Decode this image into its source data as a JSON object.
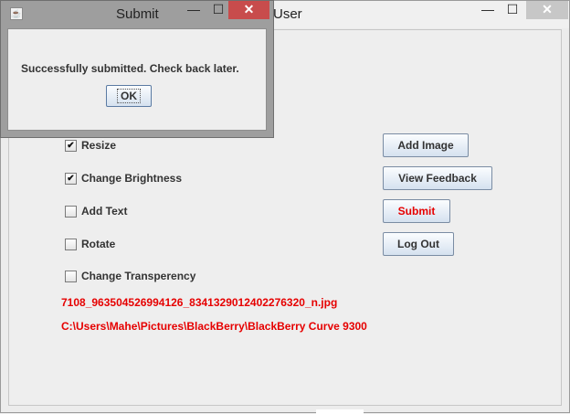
{
  "main_window": {
    "title": "User",
    "controls": {
      "minimize": "—",
      "maximize": "☐",
      "close": "✕"
    }
  },
  "options": [
    {
      "label": "Resize",
      "checked": true
    },
    {
      "label": "Change Brightness",
      "checked": true
    },
    {
      "label": "Add Text",
      "checked": false
    },
    {
      "label": "Rotate",
      "checked": false
    },
    {
      "label": "Change Transperency",
      "checked": false
    }
  ],
  "buttons": {
    "add_image": "Add Image",
    "view_feedback": "View Feedback",
    "submit": "Submit",
    "log_out": "Log Out"
  },
  "file_info": {
    "file_name": "7108_963504526994126_8341329012402276320_n.jpg",
    "file_path": "C:\\Users\\Mahe\\Pictures\\BlackBerry\\BlackBerry Curve 9300"
  },
  "dialog": {
    "title": "Submit",
    "message": "Successfully submitted. Check back later.",
    "ok_label": "OK",
    "controls": {
      "minimize": "—",
      "maximize": "☐",
      "close": "✕"
    }
  },
  "colors": {
    "accent_red": "#e60000",
    "close_red": "#c84c4c"
  },
  "icons": {
    "dialog_app_icon": "java-icon",
    "check_mark": "✔"
  }
}
